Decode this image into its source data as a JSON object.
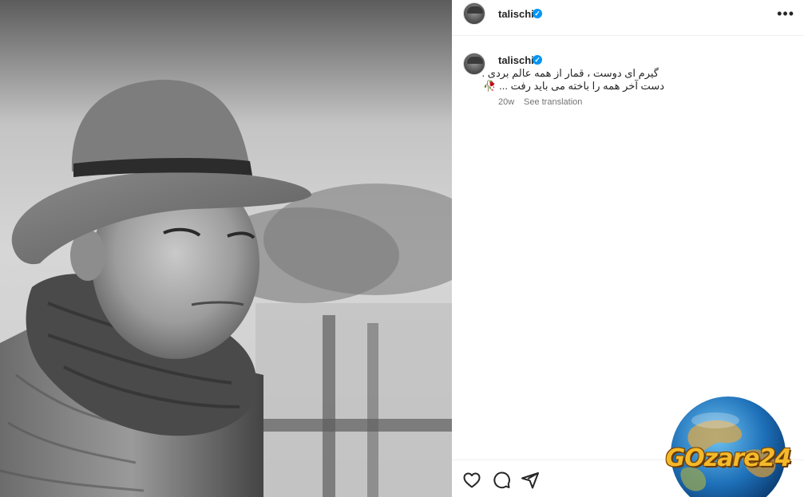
{
  "post": {
    "username": "talischi",
    "verified_glyph": "✓",
    "more_glyph": "•••"
  },
  "caption": {
    "username": "talischi",
    "line1": "گیرم ای دوست ، قمار از همه عالم بردی .",
    "line2": "دست آخر همه را باخته می باید رفت ...",
    "emoji": "🥀",
    "age": "20w",
    "see_translation": "See translation"
  },
  "actions": {
    "icons": [
      "heart-icon",
      "comment-icon",
      "share-icon"
    ]
  },
  "watermark": {
    "text": "GOzare24"
  },
  "colors": {
    "verified": "#0095f6",
    "watermark_text": "#f4b92a",
    "text_primary": "#262626",
    "text_secondary": "#737373"
  }
}
